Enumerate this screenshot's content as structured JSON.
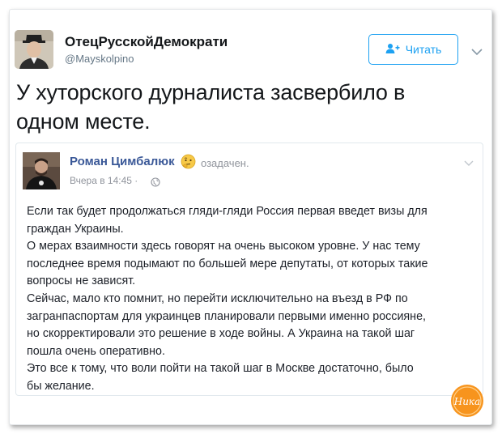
{
  "tweet": {
    "author_name": "ОтецРусскойДемократи",
    "author_handle": "@Mayskolpino",
    "follow_label": "Читать",
    "text_line1": "У хуторского дурналиста засвербило в",
    "text_line2": "одном месте."
  },
  "quoted_post": {
    "author_name": "Роман Цимбалюк",
    "feeling": "озадачен.",
    "timestamp": "Вчера в 14:45 ·",
    "paragraphs": [
      [
        "Если так будет продолжаться гляди-гляди Россия первая введет визы для",
        "граждан Украины."
      ],
      [
        "О мерах взаимности здесь говорят на очень высоком уровне. У нас тему",
        "последнее время подымают по большей мере депутаты, от которых такие",
        "вопросы не зависят."
      ],
      [
        "Сейчас, мало кто помнит, но перейти исключительно на въезд в РФ по",
        "загранпаспортам для украинцев планировали первыми именно россияне,",
        "но скорректировали это решение в ходе войны. А Украина на такой шаг",
        "пошла очень оперативно."
      ],
      [
        "Это все к тому, что воли пойти на такой шаг в Москве достаточно, было",
        "бы желание."
      ]
    ]
  },
  "watermark": {
    "text": "Ника"
  },
  "colors": {
    "accent_blue": "#1da1f2",
    "fb_blue": "#3b5998",
    "muted": "#657786",
    "watermark_orange": "#f7941d"
  },
  "icons": [
    "add-user-icon",
    "chevron-down-icon",
    "thinking-emoji-icon",
    "globe-icon"
  ]
}
